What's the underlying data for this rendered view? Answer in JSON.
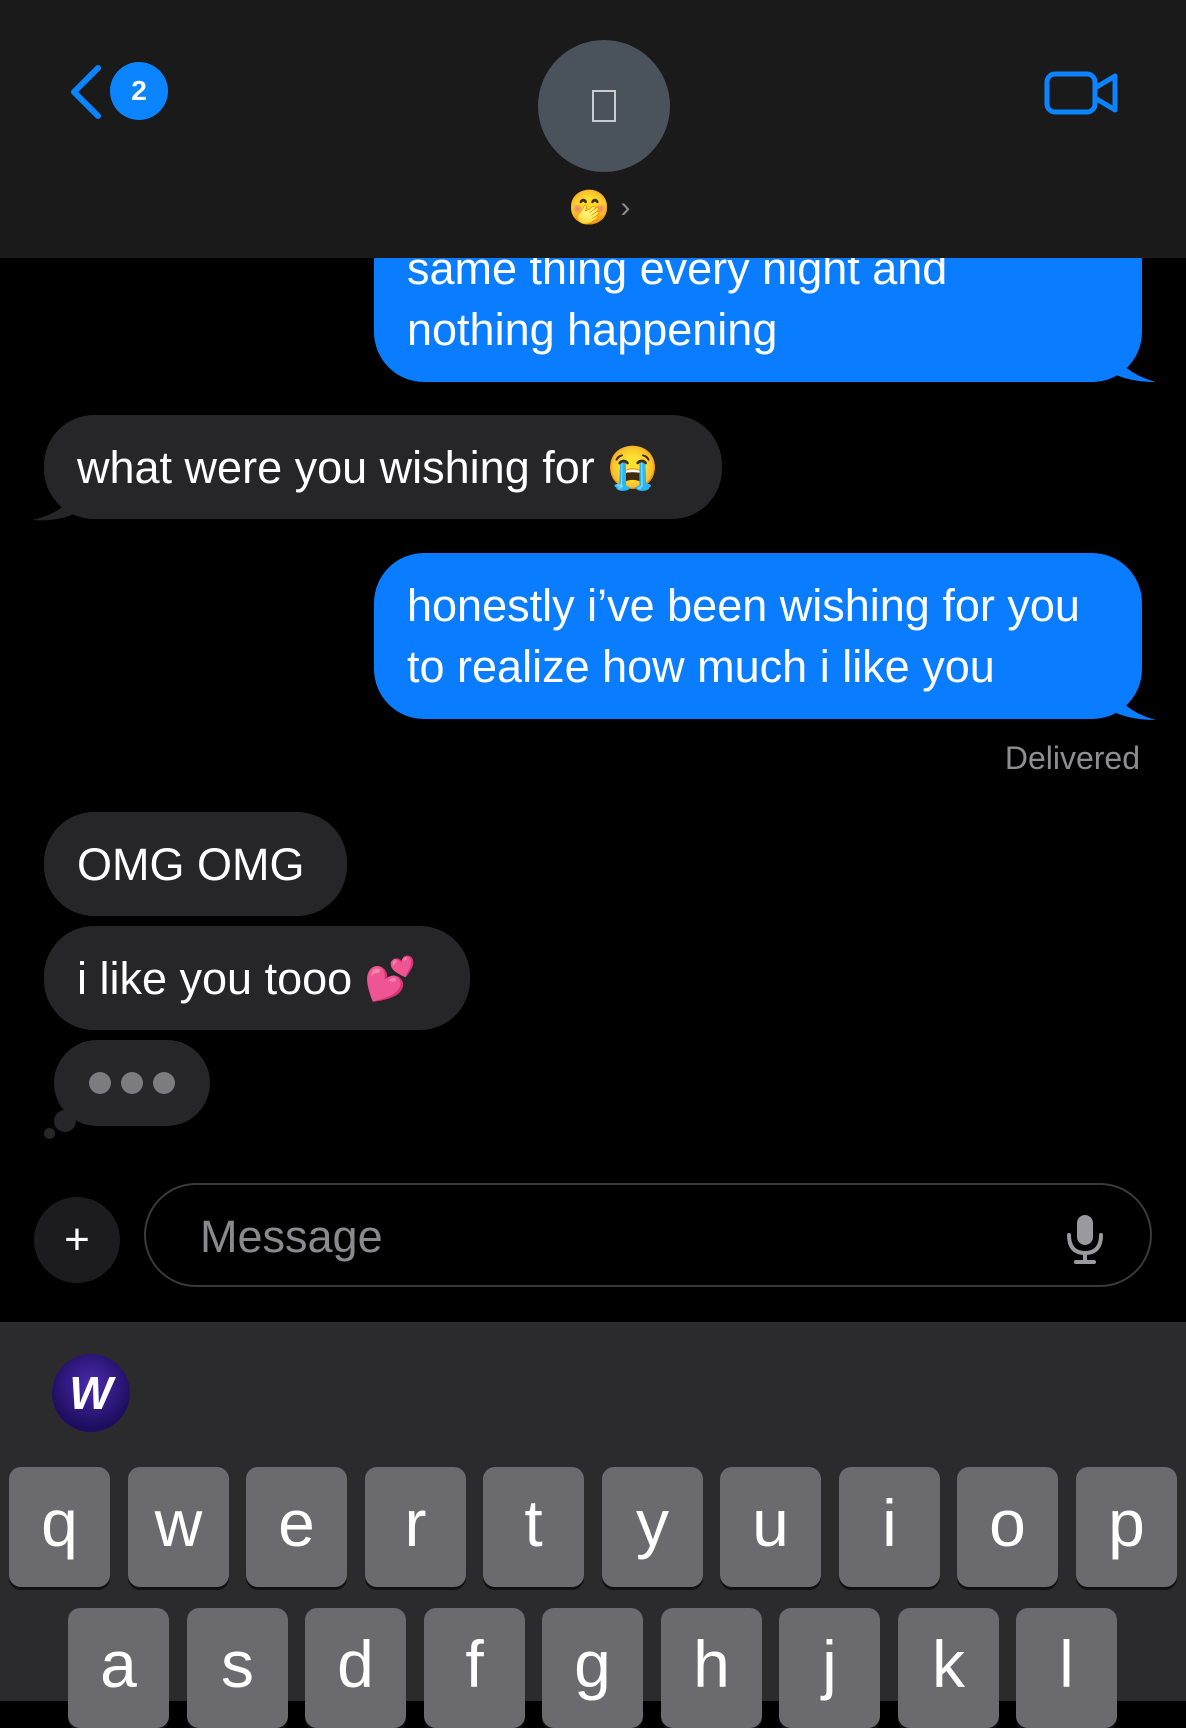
{
  "header": {
    "back_badge": "2",
    "contact_emoji": "🤭",
    "contact_chevron": "›"
  },
  "messages": [
    {
      "sender": "me",
      "line1": "same thing every night and",
      "line2": "nothing happening"
    },
    {
      "sender": "them",
      "text": "what were you wishing for",
      "emoji": "😭"
    },
    {
      "sender": "me",
      "line1": "honestly i’ve been wishing for you",
      "line2": "to realize how much i like you"
    },
    {
      "sender": "them",
      "text": "OMG OMG"
    },
    {
      "sender": "them",
      "text": "i like you tooo",
      "emoji": "💕"
    }
  ],
  "status": {
    "delivered": "Delivered"
  },
  "composer": {
    "plus": "+",
    "placeholder": "Message"
  },
  "keyboard": {
    "app_icon_letter": "W",
    "row1": [
      "q",
      "w",
      "e",
      "r",
      "t",
      "y",
      "u",
      "i",
      "o",
      "p"
    ],
    "row2": [
      "a",
      "s",
      "d",
      "f",
      "g",
      "h",
      "j",
      "k",
      "l"
    ]
  },
  "colors": {
    "sent_bubble": "#0a7cff",
    "received_bubble": "#262628",
    "accent": "#0a84ff",
    "header_bg": "#1a1a1a",
    "keyboard_bg": "#2b2b2d",
    "key_bg": "#6b6b6f"
  }
}
